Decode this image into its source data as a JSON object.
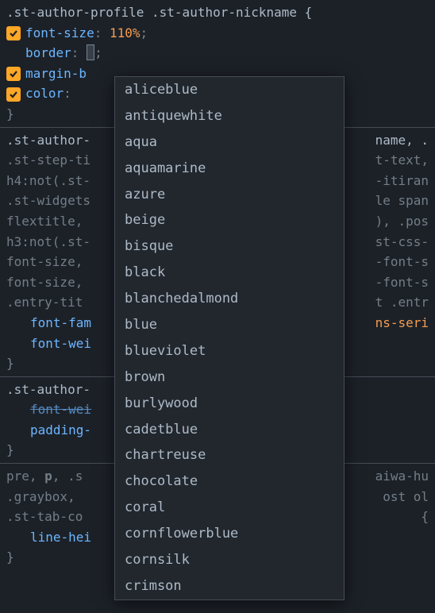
{
  "block1": {
    "selector": ".st-author-profile .st-author-nickname {",
    "rules": [
      {
        "prop": "font-size",
        "val": "110%",
        "checked": true
      },
      {
        "prop": "border",
        "val": "",
        "checked": false,
        "cursor": true
      },
      {
        "prop": "margin-b",
        "val": "",
        "checked": true,
        "truncated": true
      },
      {
        "prop": "color",
        "val": "",
        "checked": true,
        "truncated": true
      }
    ]
  },
  "block2": {
    "lines": [
      ".st-author-",
      ".st-step-ti",
      "h4:not(.st-",
      ".st-widgets",
      "flextitle,",
      "h3:not(.st-",
      "font-size,",
      "font-size,",
      ".entry-tit"
    ],
    "right": [
      "name, .",
      "t-text,",
      "-itiran",
      "le span",
      "), .pos",
      "st-css-",
      "-font-s",
      "-font-s",
      "t .entr"
    ],
    "inner": [
      {
        "prop": "font-fam",
        "right": "ns-seri"
      },
      {
        "prop": "font-wei",
        "right": ""
      }
    ]
  },
  "block3": {
    "selector_left": ".st-author-",
    "rules": [
      {
        "prop": "font-wei",
        "strike": true
      },
      {
        "prop": "padding-",
        "strike": false
      }
    ]
  },
  "block4": {
    "line1_left": "pre, ",
    "line1_bold": "p",
    "line1_after": ", .s",
    "line1_right": "aiwa-hu",
    "line2_left": ".graybox,",
    "line2_right": "ost ol ",
    "line3_left": ".st-tab-co",
    "line3_right": "{",
    "inner_prop": "line-hei"
  },
  "autocomplete": {
    "items": [
      "aliceblue",
      "antiquewhite",
      "aqua",
      "aquamarine",
      "azure",
      "beige",
      "bisque",
      "black",
      "blanchedalmond",
      "blue",
      "blueviolet",
      "brown",
      "burlywood",
      "cadetblue",
      "chartreuse",
      "chocolate",
      "coral",
      "cornflowerblue",
      "cornsilk",
      "crimson"
    ]
  }
}
